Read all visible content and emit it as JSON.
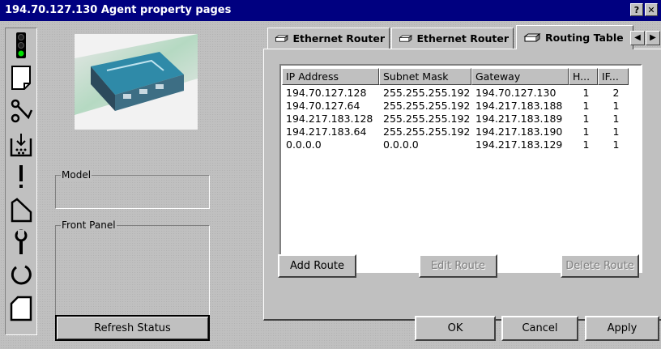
{
  "window": {
    "title": "194.70.127.130 Agent property pages",
    "help_label": "?",
    "close_label": "✕"
  },
  "sidebar_icons": [
    "traffic-light-icon",
    "page-icon",
    "ring-network-icon",
    "download-tray-icon",
    "exclamation-icon",
    "corner-shape-icon",
    "wrench-icon",
    "circular-arrow-icon",
    "folded-page-icon"
  ],
  "model_group": {
    "label": "Model"
  },
  "front_panel_group": {
    "label": "Front Panel"
  },
  "refresh_button": {
    "label": "Refresh Status"
  },
  "tabs": [
    {
      "label": "Ethernet Router"
    },
    {
      "label": "Ethernet Router"
    },
    {
      "label": "Routing Table",
      "active": true
    }
  ],
  "tab_scroll": {
    "left": "◀",
    "right": "▶"
  },
  "routing_table": {
    "columns": [
      "IP Address",
      "Subnet Mask",
      "Gateway",
      "H...",
      "IF..."
    ],
    "rows": [
      [
        "194.70.127.128",
        "255.255.255.192",
        "194.70.127.130",
        "1",
        "2"
      ],
      [
        "194.70.127.64",
        "255.255.255.192",
        "194.217.183.188",
        "1",
        "1"
      ],
      [
        "194.217.183.128",
        "255.255.255.192",
        "194.217.183.189",
        "1",
        "1"
      ],
      [
        "194.217.183.64",
        "255.255.255.192",
        "194.217.183.190",
        "1",
        "1"
      ],
      [
        "0.0.0.0",
        "0.0.0.0",
        "194.217.183.129",
        "1",
        "1"
      ]
    ]
  },
  "route_buttons": {
    "add": "Add Route",
    "edit": "Edit Route",
    "delete": "Delete Route"
  },
  "dialog_buttons": {
    "ok": "OK",
    "cancel": "Cancel",
    "apply": "Apply"
  }
}
